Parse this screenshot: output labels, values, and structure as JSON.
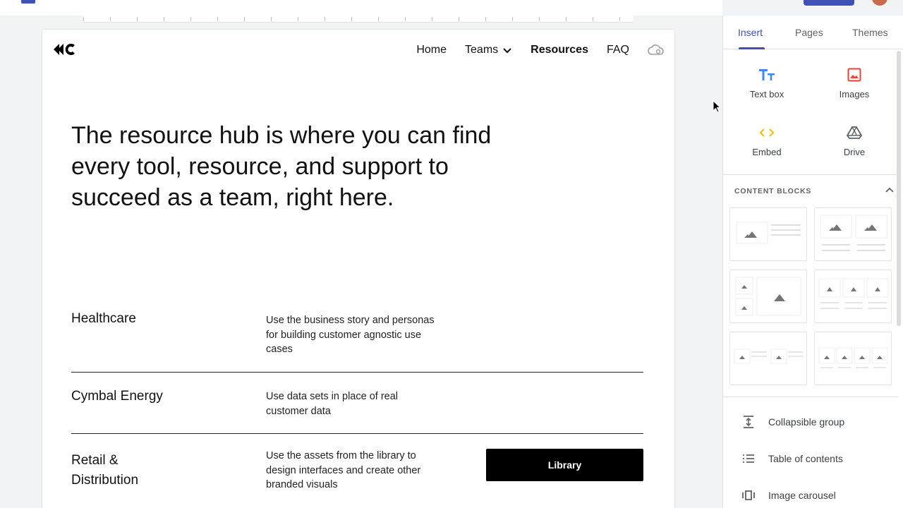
{
  "site": {
    "nav": {
      "home": "Home",
      "teams": "Teams",
      "resources": "Resources",
      "faq": "FAQ"
    },
    "hero": "The resource hub is where you can find every tool, resource, and support to succeed as a team, right here.",
    "rows": [
      {
        "title": "Healthcare",
        "desc": "Use the business story and personas for building customer agnostic use cases"
      },
      {
        "title": "Cymbal Energy",
        "desc": "Use data sets in place of real customer data"
      },
      {
        "title": "Retail & Distribution",
        "desc": "Use the assets from the  library to design interfaces and create other branded visuals"
      }
    ],
    "library_button": "Library"
  },
  "panel": {
    "tabs": [
      "Insert",
      "Pages",
      "Themes"
    ],
    "tools": {
      "text_box": "Text box",
      "images": "Images",
      "embed": "Embed",
      "drive": "Drive"
    },
    "content_blocks_header": "CONTENT BLOCKS",
    "list": {
      "collapsible": "Collapsible group",
      "toc": "Table of contents",
      "carousel": "Image carousel"
    }
  },
  "colors": {
    "accent": "#3f51b5",
    "text_box_icon": "#4285f4",
    "images_icon": "#ea4335",
    "embed_icon": "#fbbc04"
  }
}
